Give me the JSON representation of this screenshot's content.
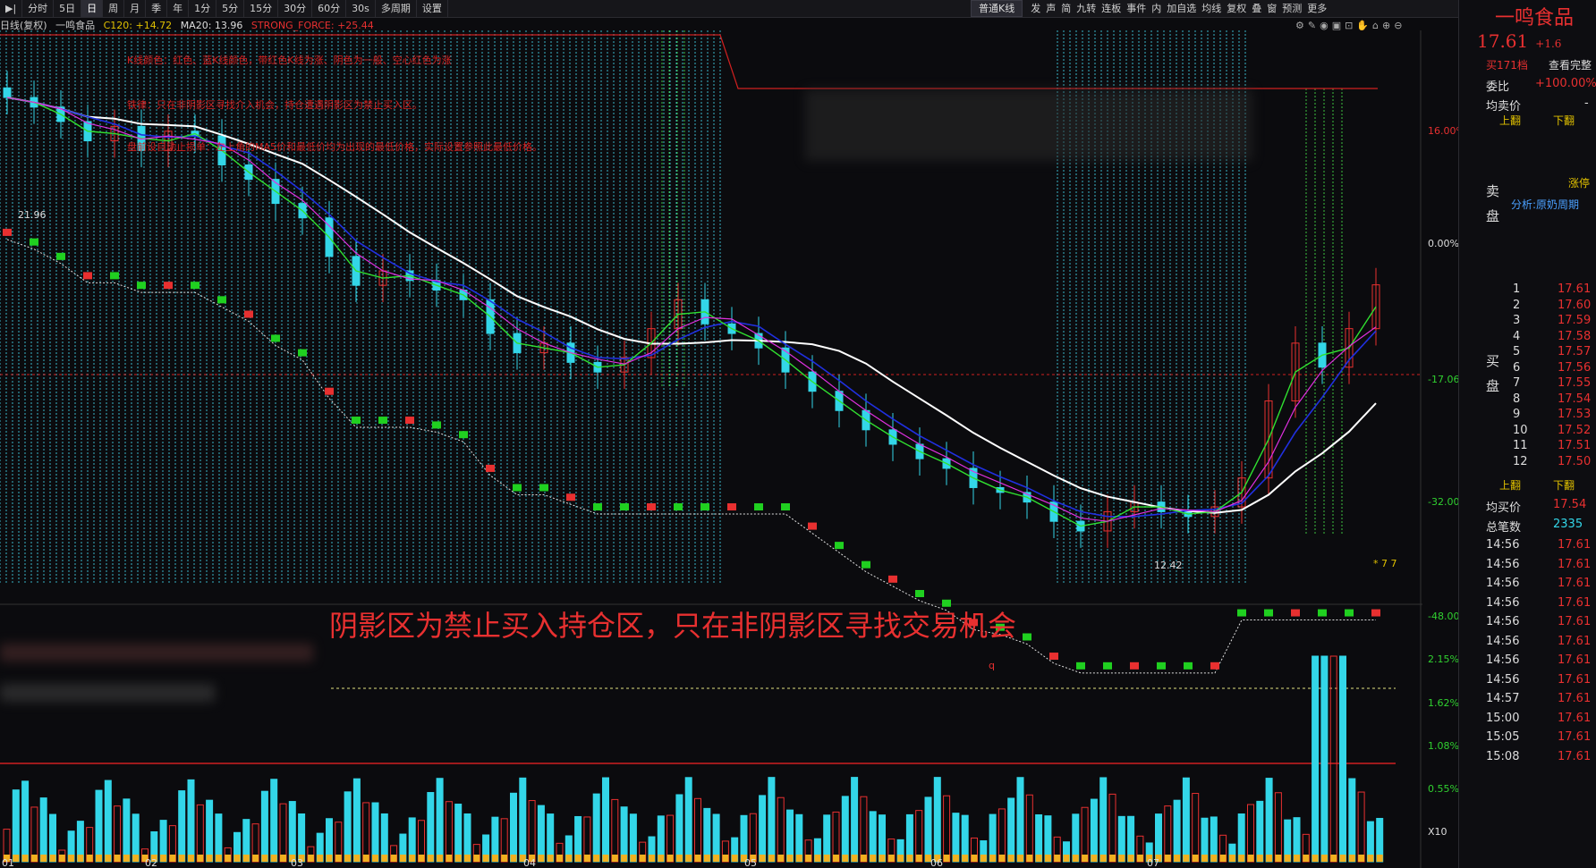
{
  "toolbar": {
    "items": [
      "分时",
      "5日",
      "日",
      "周",
      "月",
      "季",
      "年",
      "1分",
      "5分",
      "15分",
      "30分",
      "60分",
      "30s",
      "多周期",
      "设置"
    ],
    "active": "日",
    "kline_type": "普通K线",
    "right_items": [
      "发",
      "声",
      "简",
      "九转",
      "连板",
      "事件",
      "内",
      "加自选",
      "均线",
      "复权",
      "叠",
      "窗",
      "预测",
      "更多"
    ]
  },
  "infoline": {
    "title": "日线(复权)",
    "stock": "一鸣食品",
    "c120": "C120: +14.72",
    "ma20": "MA20: 13.96",
    "strong": "STRONG_FORCE: +25.44"
  },
  "notes": {
    "n1": "K线颜色：红色、蓝K线颜色，带红色K线为涨、阴色为一般、空心红色为涨",
    "n2": "铁律：只在非阴影区寻找介入机会，持仓遭遇阴影区为禁止买入区。",
    "n3": "盘前设自动止损单：左上角的MA5价和最低价均为出现的最低价格，实际设置参照此最低价格。",
    "banner": "阴影区为禁止买入持仓区，只在非阴影区寻找交易机会"
  },
  "chart_labels": {
    "high": "21.96",
    "low": "12.42",
    "q": "q",
    "stars": "* 7 7",
    "x10": "X10"
  },
  "pct_axis": [
    "16.00%",
    "0.00%",
    "-17.06%",
    "-32.00%",
    "-48.00%"
  ],
  "vol_axis": [
    "2.15%",
    "1.62%",
    "1.08%",
    "0.55%"
  ],
  "months": [
    "01",
    "02",
    "03",
    "04",
    "05",
    "06",
    "07"
  ],
  "right_panel": {
    "name": "一鸣食品",
    "price": "17.61",
    "change": "+1.6",
    "buy_levels": "买171档",
    "view_all": "查看完整",
    "weibi_label": "委比",
    "weibi_val": "+100.00%",
    "avg_sell_label": "均卖价",
    "avg_sell_val": "-",
    "up_label": "上翻",
    "down_label": "下翻",
    "sell_label": "卖盘",
    "zhangting": "涨停",
    "analysis": "分析:原奶周期",
    "buy_label": "买盘",
    "avg_buy_label": "均买价",
    "avg_buy_val": "17.54",
    "total_label": "总笔数",
    "total_val": "2335",
    "bids": [
      {
        "n": "1",
        "p": "17.61"
      },
      {
        "n": "2",
        "p": "17.60"
      },
      {
        "n": "3",
        "p": "17.59"
      },
      {
        "n": "4",
        "p": "17.58"
      },
      {
        "n": "5",
        "p": "17.57"
      },
      {
        "n": "6",
        "p": "17.56"
      },
      {
        "n": "7",
        "p": "17.55"
      },
      {
        "n": "8",
        "p": "17.54"
      },
      {
        "n": "9",
        "p": "17.53"
      },
      {
        "n": "10",
        "p": "17.52"
      },
      {
        "n": "11",
        "p": "17.51"
      },
      {
        "n": "12",
        "p": "17.50"
      }
    ],
    "trades": [
      {
        "t": "14:56",
        "p": "17.61"
      },
      {
        "t": "14:56",
        "p": "17.61"
      },
      {
        "t": "14:56",
        "p": "17.61"
      },
      {
        "t": "14:56",
        "p": "17.61"
      },
      {
        "t": "14:56",
        "p": "17.61"
      },
      {
        "t": "14:56",
        "p": "17.61"
      },
      {
        "t": "14:56",
        "p": "17.61"
      },
      {
        "t": "14:56",
        "p": "17.61"
      },
      {
        "t": "14:57",
        "p": "17.61"
      },
      {
        "t": "15:00",
        "p": "17.61"
      },
      {
        "t": "15:05",
        "p": "17.61"
      },
      {
        "t": "15:08",
        "p": "17.61"
      }
    ]
  },
  "chart_data": {
    "type": "candlestick",
    "high_label": 21.96,
    "low_label": 12.42,
    "closes": [
      21.5,
      21.3,
      21.0,
      20.6,
      20.9,
      20.4,
      20.8,
      20.7,
      20.1,
      19.8,
      19.3,
      19.0,
      18.2,
      17.6,
      17.9,
      17.7,
      17.5,
      17.3,
      16.6,
      16.2,
      16.4,
      16.0,
      15.8,
      16.1,
      16.7,
      17.3,
      16.8,
      16.6,
      16.3,
      15.8,
      15.4,
      15.0,
      14.6,
      14.3,
      14.0,
      13.8,
      13.4,
      13.3,
      13.1,
      12.7,
      12.5,
      12.9,
      13.1,
      12.9,
      12.8,
      13.0,
      13.6,
      15.2,
      16.4,
      15.9,
      16.7,
      17.61
    ]
  }
}
